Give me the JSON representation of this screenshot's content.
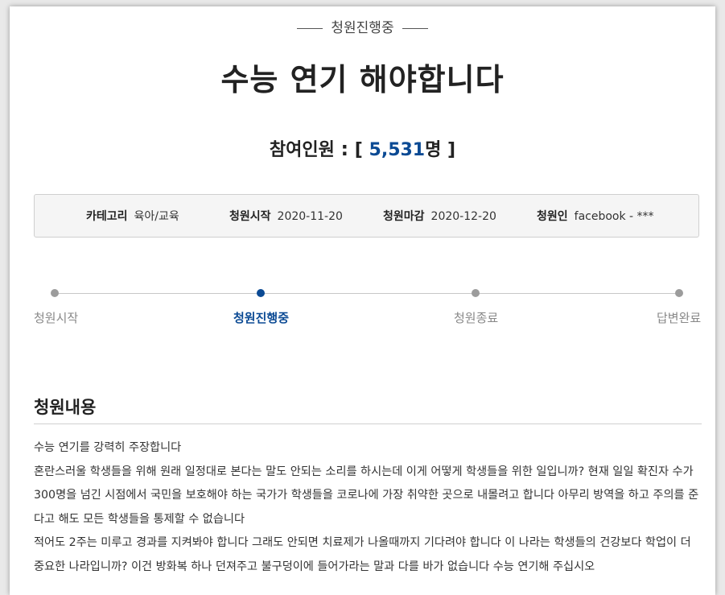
{
  "status": "청원진행중",
  "title": "수능 연기 해야합니다",
  "participants": {
    "label": "참여인원",
    "colon": ":",
    "open_bracket": "[",
    "count": "5,531",
    "unit": "명",
    "close_bracket": "]"
  },
  "info": {
    "category_label": "카테고리",
    "category_value": "육아/교육",
    "start_label": "청원시작",
    "start_value": "2020-11-20",
    "end_label": "청원마감",
    "end_value": "2020-12-20",
    "author_label": "청원인",
    "author_value": "facebook - ***"
  },
  "progress": {
    "steps": [
      {
        "label": "청원시작",
        "active": false
      },
      {
        "label": "청원진행중",
        "active": true
      },
      {
        "label": "청원종료",
        "active": false
      },
      {
        "label": "답변완료",
        "active": false
      }
    ]
  },
  "content": {
    "title": "청원내용",
    "lines": [
      "수능 연기를 강력히 주장합니다",
      "혼란스러울 학생들을 위해 원래 일정대로 본다는 말도 안되는 소리를 하시는데 이게 어떻게 학생들을 위한 일입니까? 현재 일일 확진자 수가 300명을 넘긴 시점에서 국민을 보호해야 하는 국가가 학생들을 코로나에 가장 취약한 곳으로 내몰려고 합니다 아무리 방역을 하고 주의를 준다고 해도 모든 학생들을 통제할 수 없습니다",
      "적어도 2주는 미루고 경과를 지켜봐야 합니다 그래도 안되면 치료제가 나올때까지 기다려야 합니다 이 나라는 학생들의 건강보다 학업이 더 중요한 나라입니까? 이건 방화복 하나 던져주고 불구덩이에 들어가라는 말과 다를 바가 없습니다 수능 연기해 주십시오"
    ]
  },
  "colors": {
    "accent": "#0b4a94",
    "inactive_dot": "#9c9c9c",
    "info_bg": "#f5f5f5"
  }
}
